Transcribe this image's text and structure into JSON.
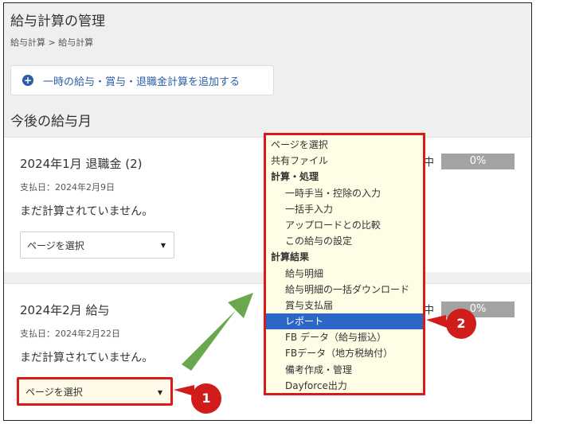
{
  "header": {
    "title": "給与計算の管理",
    "breadcrumb": "給与計算 > 給与計算"
  },
  "add_button": {
    "label": "一時の給与・賞与・退職金計算を追加する"
  },
  "section_title": "今後の給与月",
  "cards": [
    {
      "title": "2024年1月 退職金 (2)",
      "pay_date": "支払日：2024年2月9日",
      "status_text": "まだ計算されていません。",
      "select_label": "ページを選択",
      "status_tag": "中",
      "progress": "0%"
    },
    {
      "title": "2024年2月 給与",
      "pay_date": "支払日：2024年2月22日",
      "status_text": "まだ計算されていません。",
      "select_label": "ページを選択",
      "status_tag": "中",
      "progress": "0%"
    }
  ],
  "dropdown": {
    "items": [
      {
        "label": "ページを選択",
        "kind": "option"
      },
      {
        "label": "共有ファイル",
        "kind": "option"
      },
      {
        "label": "計算・処理",
        "kind": "group"
      },
      {
        "label": "一時手当・控除の入力",
        "kind": "sub"
      },
      {
        "label": "一括手入力",
        "kind": "sub"
      },
      {
        "label": "アップロードとの比較",
        "kind": "sub"
      },
      {
        "label": "この給与の設定",
        "kind": "sub"
      },
      {
        "label": "計算結果",
        "kind": "group"
      },
      {
        "label": "給与明細",
        "kind": "sub"
      },
      {
        "label": "給与明細の一括ダウンロード",
        "kind": "sub"
      },
      {
        "label": "賞与支払届",
        "kind": "sub"
      },
      {
        "label": "レポート",
        "kind": "sub",
        "selected": true
      },
      {
        "label": "FB データ（給与振込）",
        "kind": "sub"
      },
      {
        "label": "FBデータ（地方税納付）",
        "kind": "sub"
      },
      {
        "label": "備考作成・管理",
        "kind": "sub"
      },
      {
        "label": "Dayforce出力",
        "kind": "sub"
      }
    ]
  },
  "markers": [
    "1",
    "2"
  ],
  "colors": {
    "highlight_red": "#d91a1a",
    "selected_blue": "#2a67c7",
    "arrow_green": "#6aa84f",
    "link_blue": "#2b5ea6"
  }
}
